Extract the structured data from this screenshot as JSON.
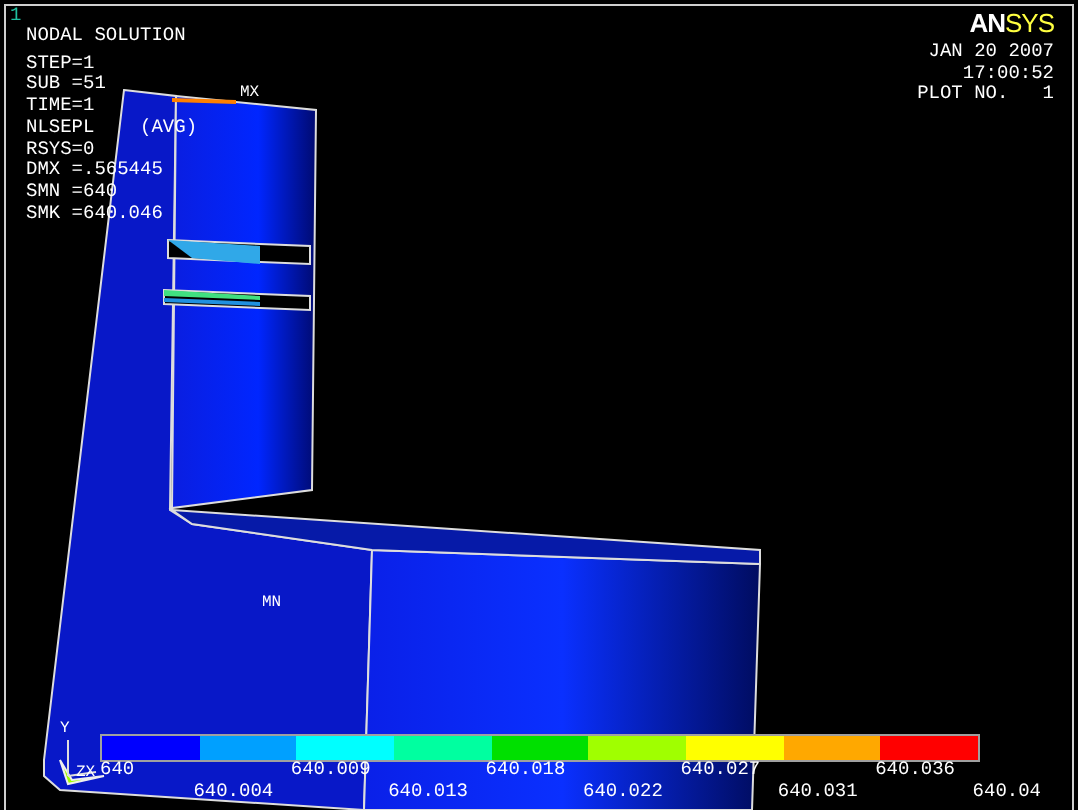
{
  "window_number": "1",
  "title": "NODAL SOLUTION",
  "info_lines": [
    "STEP=1",
    "SUB =51",
    "TIME=1",
    "NLSEPL    (AVG)",
    "RSYS=0",
    "DMX =.565445",
    "SMN =640",
    "SMK =640.046"
  ],
  "logo": {
    "part_1": "AN",
    "part_2": "SYS"
  },
  "date": "JAN 20 2007",
  "time": "17:00:52",
  "plot_number": {
    "label": "PLOT NO.",
    "value": "1"
  },
  "markers": {
    "max": "MX",
    "min": "MN"
  },
  "triad": {
    "y": "Y",
    "zx": "ZX"
  },
  "legend": {
    "segments": [
      {
        "color": "#0000ff"
      },
      {
        "color": "#00a0ff"
      },
      {
        "color": "#00ffff"
      },
      {
        "color": "#00ffa0"
      },
      {
        "color": "#00e000"
      },
      {
        "color": "#a0ff00"
      },
      {
        "color": "#ffff00"
      },
      {
        "color": "#ffa800"
      },
      {
        "color": "#ff0000"
      }
    ],
    "labels": [
      "640",
      "640.004",
      "640.009",
      "640.013",
      "640.018",
      "640.022",
      "640.027",
      "640.031",
      "640.036",
      "640.04"
    ]
  }
}
